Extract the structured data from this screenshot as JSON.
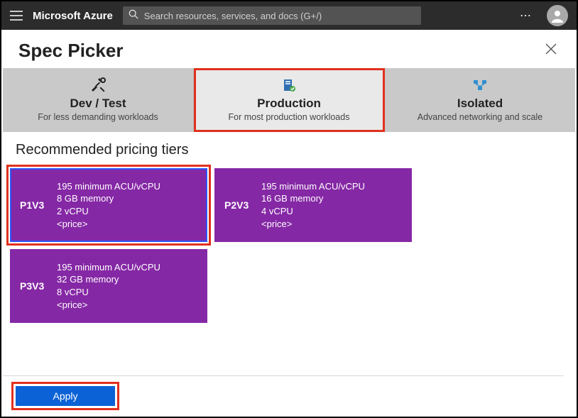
{
  "header": {
    "brand": "Microsoft Azure",
    "search_placeholder": "Search resources, services, and docs (G+/)"
  },
  "page": {
    "title": "Spec Picker"
  },
  "tabs": [
    {
      "title": "Dev / Test",
      "subtitle": "For less demanding workloads",
      "active": false
    },
    {
      "title": "Production",
      "subtitle": "For most production workloads",
      "active": true
    },
    {
      "title": "Isolated",
      "subtitle": "Advanced networking and scale",
      "active": false
    }
  ],
  "section": {
    "title": "Recommended pricing tiers"
  },
  "tiers": [
    {
      "name": "P1V3",
      "acu": "195 minimum ACU/vCPU",
      "memory": "8 GB memory",
      "vcpu": "2 vCPU",
      "price": "<price>",
      "selected": true
    },
    {
      "name": "P2V3",
      "acu": "195 minimum ACU/vCPU",
      "memory": "16 GB memory",
      "vcpu": "4 vCPU",
      "price": "<price>",
      "selected": false
    },
    {
      "name": "P3V3",
      "acu": "195 minimum ACU/vCPU",
      "memory": "32 GB memory",
      "vcpu": "8 vCPU",
      "price": "<price>",
      "selected": false
    }
  ],
  "footer": {
    "apply_label": "Apply"
  },
  "colors": {
    "tier_card": "#8528a5",
    "apply_button": "#0b62d6",
    "highlight": "#e1301e"
  }
}
